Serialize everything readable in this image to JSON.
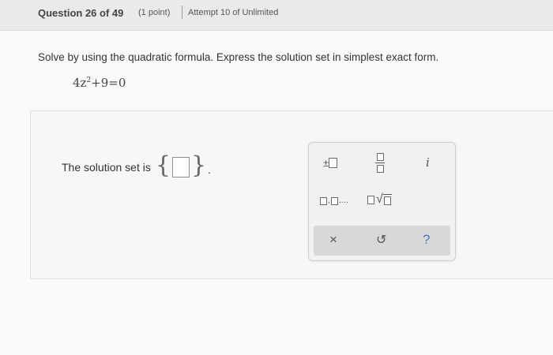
{
  "header": {
    "question": "Question 26 of 49",
    "points": "(1 point)",
    "attempt": "Attempt 10 of Unlimited"
  },
  "prompt": {
    "instruction": "Solve by using the quadratic formula. Express the solution set in simplest exact form.",
    "equation_base": "4z",
    "equation_exponent": "2",
    "equation_rest": "+9=0"
  },
  "answer": {
    "label": "The solution set is",
    "brace_open": "{",
    "brace_close": "}",
    "period": ".",
    "value": ""
  },
  "palette": {
    "plus_minus": "±",
    "imaginary_unit": "i",
    "list_ellipsis": "....",
    "sqrt_symbol": "√",
    "clear_symbol": "×",
    "undo_symbol": "↺",
    "help_symbol": "?"
  },
  "colors": {
    "help_accent": "#3d7bc2",
    "header_bg": "#eaeaea"
  }
}
